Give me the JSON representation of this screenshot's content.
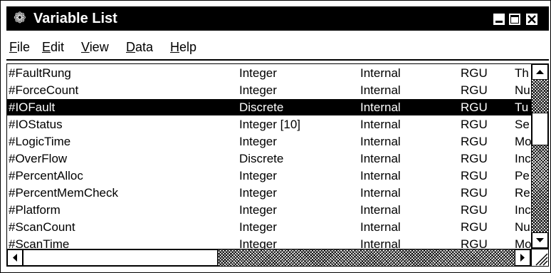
{
  "window": {
    "title": "Variable List",
    "app_icon": "gear-icon"
  },
  "menubar": [
    {
      "key": "F",
      "rest": "ile"
    },
    {
      "key": "E",
      "rest": "dit"
    },
    {
      "key": "V",
      "rest": "iew"
    },
    {
      "key": "D",
      "rest": "ata"
    },
    {
      "key": "H",
      "rest": "elp"
    }
  ],
  "variables": [
    {
      "name": "#FaultRung",
      "type": "Integer",
      "scope": "Internal",
      "access": "RGU",
      "desc": "Th"
    },
    {
      "name": "#ForceCount",
      "type": "Integer",
      "scope": "Internal",
      "access": "RGU",
      "desc": "Nu"
    },
    {
      "name": "#IOFault",
      "type": "Discrete",
      "scope": "Internal",
      "access": "RGU",
      "desc": "Tu"
    },
    {
      "name": "#IOStatus",
      "type": "Integer [10]",
      "scope": "Internal",
      "access": "RGU",
      "desc": "Se"
    },
    {
      "name": "#LogicTime",
      "type": "Integer",
      "scope": "Internal",
      "access": "RGU",
      "desc": "Mo"
    },
    {
      "name": "#OverFlow",
      "type": "Discrete",
      "scope": "Internal",
      "access": "RGU",
      "desc": "Inc"
    },
    {
      "name": "#PercentAlloc",
      "type": "Integer",
      "scope": "Internal",
      "access": "RGU",
      "desc": "Pe"
    },
    {
      "name": "#PercentMemCheck",
      "type": "Integer",
      "scope": "Internal",
      "access": "RGU",
      "desc": "Re"
    },
    {
      "name": "#Platform",
      "type": "Integer",
      "scope": "Internal",
      "access": "RGU",
      "desc": "Inc"
    },
    {
      "name": "#ScanCount",
      "type": "Integer",
      "scope": "Internal",
      "access": "RGU",
      "desc": "Nu"
    },
    {
      "name": "#ScanTime",
      "type": "Integer",
      "scope": "Internal",
      "access": "RGU",
      "desc": "Mo"
    }
  ],
  "selected_row": "#IOFault"
}
